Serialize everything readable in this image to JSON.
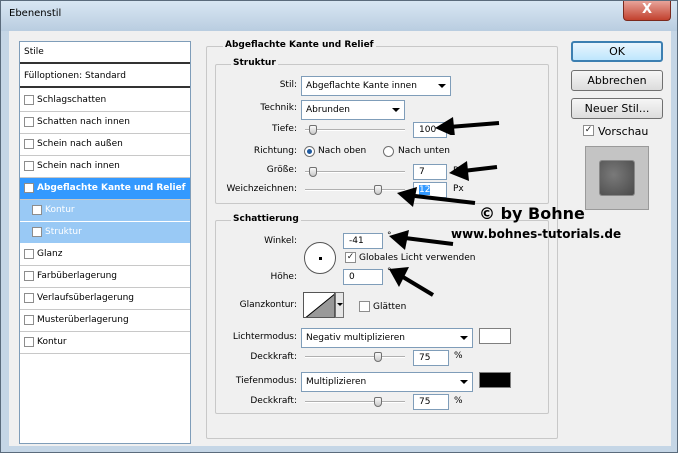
{
  "window": {
    "title": "Ebenenstil",
    "close_label": "X"
  },
  "left_list": {
    "items": [
      {
        "label": "Stile",
        "type": "head"
      },
      {
        "label": "Fülloptionen: Standard",
        "type": "head"
      },
      {
        "label": "Schlagschatten",
        "checked": false
      },
      {
        "label": "Schatten nach innen",
        "checked": false
      },
      {
        "label": "Schein nach außen",
        "checked": false
      },
      {
        "label": "Schein nach innen",
        "checked": false
      },
      {
        "label": "Abgeflachte Kante und Relief",
        "checked": true,
        "selected": true
      },
      {
        "label": "Kontur",
        "checked": false,
        "sub": true
      },
      {
        "label": "Struktur",
        "checked": false,
        "sub": true
      },
      {
        "label": "Glanz",
        "checked": false
      },
      {
        "label": "Farbüberlagerung",
        "checked": false
      },
      {
        "label": "Verlaufsüberlagerung",
        "checked": false
      },
      {
        "label": "Musterüberlagerung",
        "checked": false
      },
      {
        "label": "Kontur",
        "checked": false
      }
    ]
  },
  "panel": {
    "title": "Abgeflachte Kante und Relief",
    "struktur": {
      "title": "Struktur",
      "stil_label": "Stil:",
      "stil_value": "Abgeflachte Kante innen",
      "technik_label": "Technik:",
      "technik_value": "Abrunden",
      "tiefe_label": "Tiefe:",
      "tiefe_value": "100",
      "tiefe_level": 0.04,
      "richtung_label": "Richtung:",
      "richtung_up": "Nach oben",
      "richtung_down": "Nach unten",
      "groesse_label": "Größe:",
      "groesse_value": "7",
      "groesse_unit": "Px",
      "groesse_level": 0.04,
      "weich_label": "Weichzeichnen:",
      "weich_value": "12",
      "weich_unit": "Px",
      "weich_level": 0.75
    },
    "schattierung": {
      "title": "Schattierung",
      "winkel_label": "Winkel:",
      "winkel_value": "-41",
      "winkel_unit": "°",
      "global_light_label": "Globales Licht verwenden",
      "hoehe_label": "Höhe:",
      "hoehe_value": "0",
      "hoehe_unit": "°",
      "glanzkontur_label": "Glanzkontur:",
      "glaetten_label": "Glätten",
      "lichtermodus_label": "Lichtermodus:",
      "lichtermodus_value": "Negativ multiplizieren",
      "lichter_color": "#ffffff",
      "deckkraft1_label": "Deckkraft:",
      "deckkraft1_value": "75",
      "deckkraft1_level": 0.75,
      "deckkraft_unit": "%",
      "tiefenmodus_label": "Tiefenmodus:",
      "tiefenmodus_value": "Multiplizieren",
      "tiefen_color": "#000000",
      "deckkraft2_label": "Deckkraft:",
      "deckkraft2_value": "75",
      "deckkraft2_level": 0.75
    }
  },
  "buttons": {
    "ok": "OK",
    "cancel": "Abbrechen",
    "new_style": "Neuer Stil...",
    "preview_label": "Vorschau"
  },
  "watermark": {
    "line1": "© by Bohne",
    "line2": "www.bohnes-tutorials.de"
  },
  "icons": [
    "checkmark-icon",
    "dropdown-arrow-icon",
    "annotation-arrow-icon",
    "close-icon"
  ]
}
